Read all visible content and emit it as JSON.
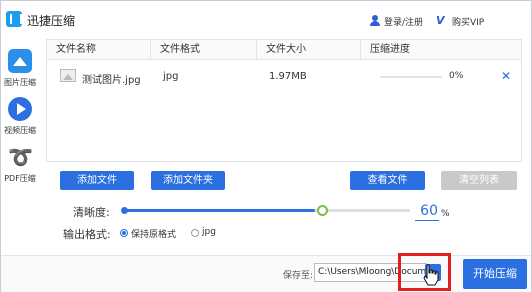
{
  "app": {
    "title": "迅捷压缩"
  },
  "header": {
    "login_label": "登录/注册",
    "vip_icon_text": "V",
    "vip_label": "购买VIP"
  },
  "sidebar": {
    "items": [
      {
        "label": "图片压缩",
        "icon": "image-icon"
      },
      {
        "label": "视频压缩",
        "icon": "video-play-icon"
      },
      {
        "label": "PDF压缩",
        "icon": "pdf-icon"
      }
    ]
  },
  "table": {
    "columns": [
      "文件名称",
      "文件格式",
      "文件大小",
      "压缩进度"
    ],
    "rows": [
      {
        "name": "测试图片.jpg",
        "format": "jpg",
        "size": "1.97MB",
        "progress": "0%",
        "progress_value": 0
      }
    ]
  },
  "actions": {
    "add_file": "添加文件",
    "add_folder": "添加文件夹",
    "view_file": "查看文件",
    "clear_list": "清空列表"
  },
  "settings": {
    "clarity_label": "清晰度:",
    "clarity_value": "60",
    "clarity_unit": "%",
    "clarity_fraction": 0.6,
    "output_label": "输出格式:",
    "output_options": [
      {
        "label": "保持原格式",
        "selected": true
      },
      {
        "label": "jpg",
        "selected": false
      }
    ]
  },
  "footer": {
    "save_label": "保存至:",
    "save_path": "C:\\Users\\Mloong\\Docum",
    "start_button": "开始压缩"
  },
  "colors": {
    "accent": "#2b6fe0",
    "highlight": "#e02020",
    "slider_thumb": "#7ac143"
  }
}
